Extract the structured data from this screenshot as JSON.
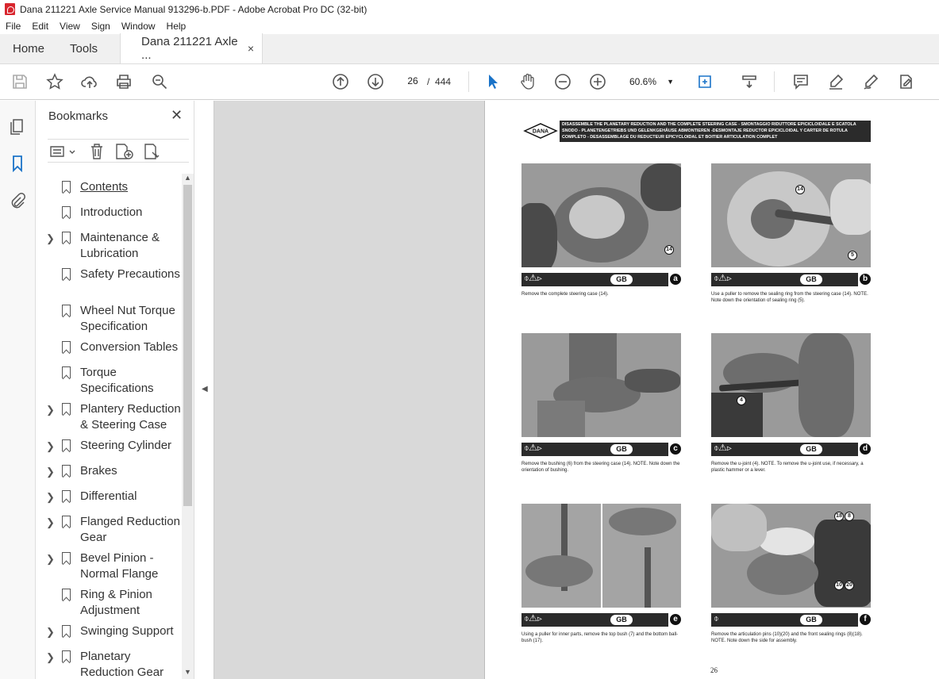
{
  "window": {
    "title": "Dana 211221 Axle Service Manual 913296-b.PDF - Adobe Acrobat Pro DC (32-bit)"
  },
  "menu": [
    "File",
    "Edit",
    "View",
    "Sign",
    "Window",
    "Help"
  ],
  "tabs": {
    "home": "Home",
    "tools": "Tools",
    "document": "Dana 211221 Axle ...",
    "close": "×"
  },
  "toolbar": {
    "page_current": "26",
    "page_sep": "/",
    "page_total": "444",
    "zoom": "60.6%"
  },
  "bookmarks": {
    "title": "Bookmarks",
    "items": [
      {
        "label": "Contents",
        "expandable": false
      },
      {
        "label": "Introduction",
        "expandable": false
      },
      {
        "label": "Maintenance & Lubrication",
        "expandable": true
      },
      {
        "label": "Safety Precautions",
        "expandable": false
      },
      {
        "label": "Wheel Nut Torque Specification",
        "expandable": false
      },
      {
        "label": "Conversion Tables",
        "expandable": false
      },
      {
        "label": "Torque Specifications",
        "expandable": false
      },
      {
        "label": "Plantery Reduction & Steering Case",
        "expandable": true
      },
      {
        "label": "Steering Cylinder",
        "expandable": true
      },
      {
        "label": "Brakes",
        "expandable": true
      },
      {
        "label": "Differential",
        "expandable": true
      },
      {
        "label": "Flanged Reduction Gear",
        "expandable": true
      },
      {
        "label": "Bevel Pinion - Normal Flange",
        "expandable": true
      },
      {
        "label": "Ring & Pinion Adjustment",
        "expandable": false
      },
      {
        "label": "Swinging Support",
        "expandable": true
      },
      {
        "label": "Planetary Reduction Gear",
        "expandable": true
      },
      {
        "label": "Disc Brakes",
        "expandable": true
      }
    ]
  },
  "page": {
    "logo": "DANA",
    "header": "DISASSEMBLE THE PLANETARY REDUCTION AND THE COMPLETE STEERING CASE - SMONTAGGIO RIDUTTORE EPICICLOIDALE E SCATOLA SNODO - PLANETENGETRIEBS UND GELENKGEHÄUSE ABMONTIEREN -DESMONTAJE REDUCTOR EPICICLOIDAL Y CARTER DE ROTULA COMPLETO - DESASSEMBLAGE DU REDUCTEUR EPICYCLOIDAL ET BOITIER ARTICULATION COMPLET",
    "badge": "GB",
    "page_number": "26",
    "figures": [
      {
        "letter": "a",
        "callouts": [
          "14"
        ],
        "caption": "Remove the complete steering case (14)."
      },
      {
        "letter": "b",
        "callouts": [
          "14",
          "5"
        ],
        "caption": "Use a puller to remove the sealing ring from the steering case (14). NOTE. Note down the orientation of sealing ring (5)."
      },
      {
        "letter": "c",
        "callouts": [],
        "caption": "Remove the bushing (6) from the steering case (14). NOTE. Note down the orientation of bushing."
      },
      {
        "letter": "d",
        "callouts": [
          "4"
        ],
        "caption": "Remove the u-joint (4). NOTE. To remove the u-joint use, if necessary, a plastic hammer or a lever."
      },
      {
        "letter": "e",
        "callouts": [],
        "caption": "Using a puller for inner parts, remove the top bush (7) and the bottom ball-bush (17)."
      },
      {
        "letter": "f",
        "callouts": [
          "18",
          "8",
          "10",
          "20"
        ],
        "caption": "Remove the articulation pins (10)(20) and the front sealing rings (8)(18). NOTE. Note down the side for assembly."
      }
    ]
  }
}
